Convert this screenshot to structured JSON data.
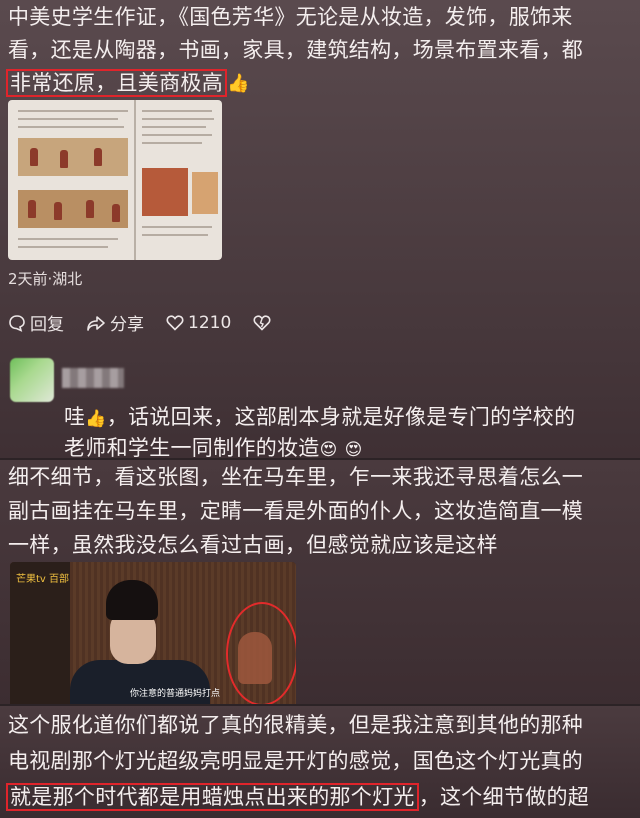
{
  "comment1": {
    "lines": [
      "中美史学生作证，《国色芳华》无论是从妆造，发饰，服饰来",
      "看，还是从陶器，书画，家具，建筑结构，场景布置来看，都",
      "非常还原，且美商极高"
    ],
    "emoji": "👍",
    "meta": "2天前·湖北",
    "actions": {
      "reply": "回复",
      "share": "分享",
      "likes": "1210"
    }
  },
  "reply1": {
    "prefix": "哇",
    "emoji_thumb": "👍",
    "line1_rest": "，话说回来，这部剧本身就是好像是专门的学校的",
    "line2": "老师和学生一同制作的妆造",
    "emoji_love": "😍",
    "emoji_love2": "😍"
  },
  "comment2": {
    "lines": [
      "细不细节，看这张图，坐在马车里，乍一来我还寻思着怎么一",
      "副古画挂在马车里，定睛一看是外面的仆人，这妆造简直一模",
      "一样，虽然我没怎么看过古画，但感觉就应该是这样"
    ],
    "video": {
      "watermark": "芒果tv 百部",
      "subtitle": "你注意的普通妈妈打点"
    }
  },
  "comment3": {
    "lines": [
      "这个服化道你们都说了真的很精美，但是我注意到其他的那种",
      "电视剧那个灯光超级亮明显是开灯的感觉，国色这个灯光真的"
    ],
    "line3_highlight": "就是那个时代都是用蜡烛点出来的那个灯光",
    "line3_rest": "，这个细节做的超"
  },
  "colors": {
    "highlight": "#e0242b",
    "text": "#f4eeee",
    "thumb": "#ffcc33"
  },
  "icons": [
    "reply-icon",
    "share-icon",
    "heart-icon",
    "dislike-heart-icon"
  ]
}
